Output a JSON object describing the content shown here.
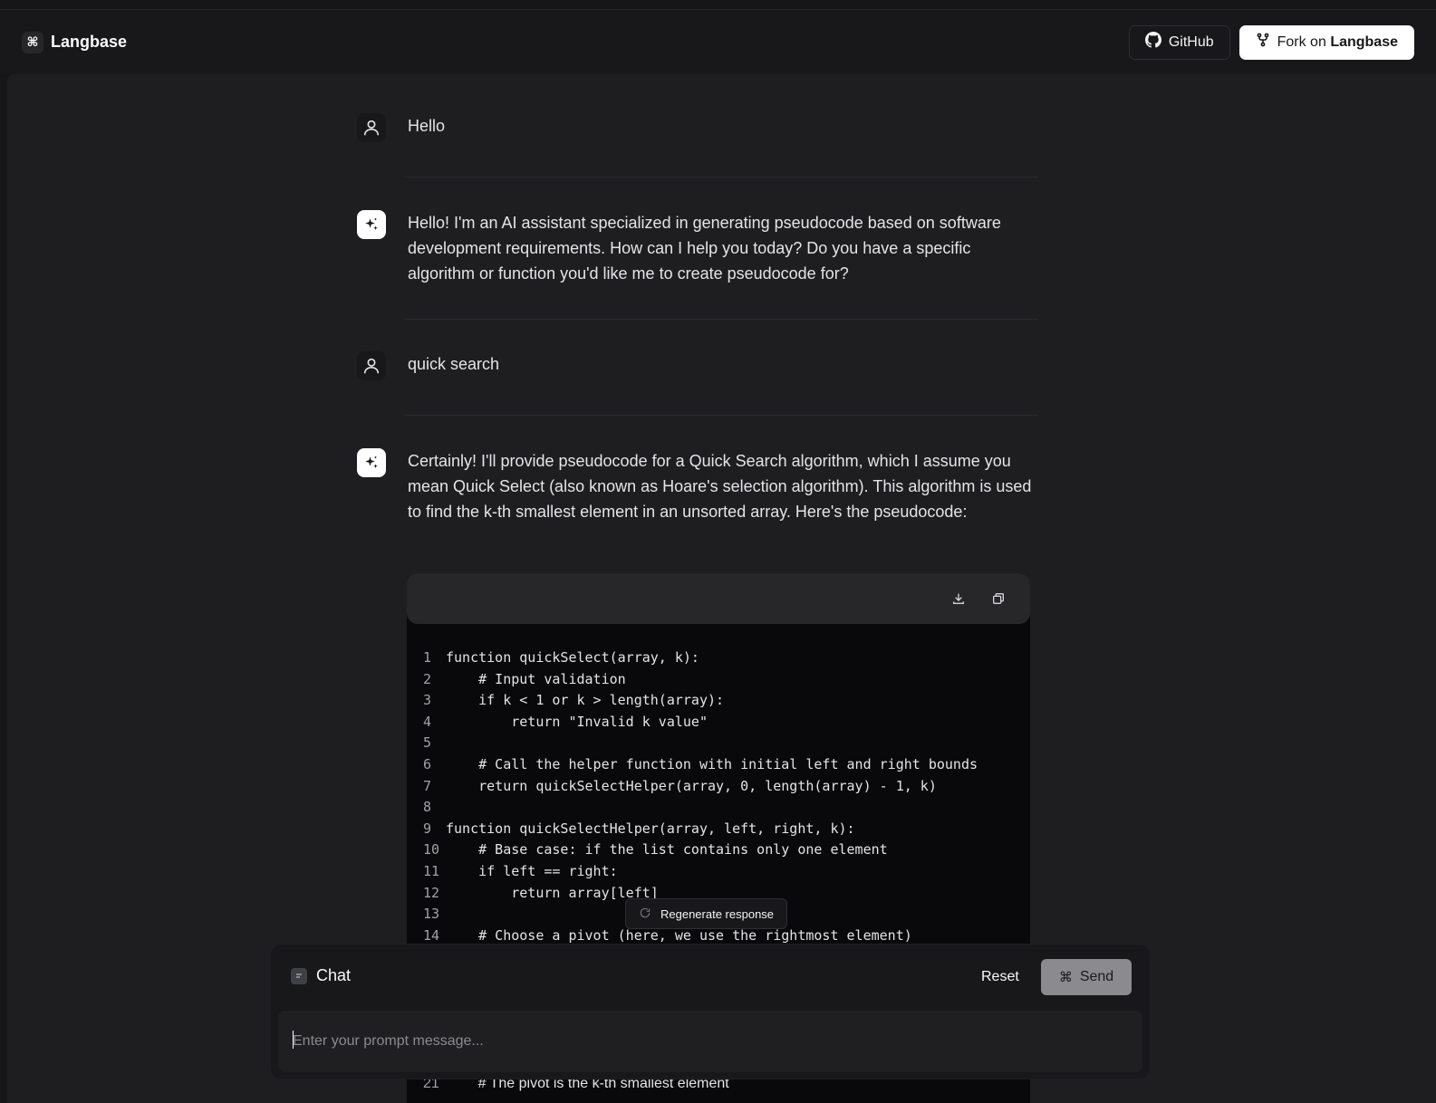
{
  "header": {
    "brand": "Langbase",
    "github_label": "GitHub",
    "fork_prefix": "Fork on",
    "fork_brand": "Langbase"
  },
  "messages": [
    {
      "role": "user",
      "text": "Hello"
    },
    {
      "role": "assistant",
      "text": "Hello! I'm an AI assistant specialized in generating pseudocode based on software development requirements. How can I help you today? Do you have a specific algorithm or function you'd like me to create pseudocode for?"
    },
    {
      "role": "user",
      "text": "quick search"
    },
    {
      "role": "assistant",
      "text": "Certainly! I'll provide pseudocode for a Quick Search algorithm, which I assume you mean Quick Select (also known as Hoare's selection algorithm). This algorithm is used to find the k-th smallest element in an unsorted array. Here's the pseudocode:"
    }
  ],
  "code": {
    "lines": [
      {
        "n": "1",
        "t": "function quickSelect(array, k):"
      },
      {
        "n": "2",
        "t": "    # Input validation"
      },
      {
        "n": "3",
        "t": "    if k < 1 or k > length(array):"
      },
      {
        "n": "4",
        "t": "        return \"Invalid k value\""
      },
      {
        "n": "5",
        "t": ""
      },
      {
        "n": "6",
        "t": "    # Call the helper function with initial left and right bounds"
      },
      {
        "n": "7",
        "t": "    return quickSelectHelper(array, 0, length(array) - 1, k)"
      },
      {
        "n": "8",
        "t": ""
      },
      {
        "n": "9",
        "t": "function quickSelectHelper(array, left, right, k):"
      },
      {
        "n": "10",
        "t": "    # Base case: if the list contains only one element"
      },
      {
        "n": "11",
        "t": "    if left == right:"
      },
      {
        "n": "12",
        "t": "        return array[left]"
      },
      {
        "n": "13",
        "t": ""
      },
      {
        "n": "14",
        "t": "    # Choose a pivot (here, we use the rightmost element)"
      }
    ],
    "tail_line": {
      "n": "21",
      "t": "        # The pivot is the k-th smallest element"
    }
  },
  "regenerate_label": "Regenerate response",
  "chat": {
    "title": "Chat",
    "reset_label": "Reset",
    "send_label": "Send",
    "placeholder": "Enter your prompt message..."
  }
}
